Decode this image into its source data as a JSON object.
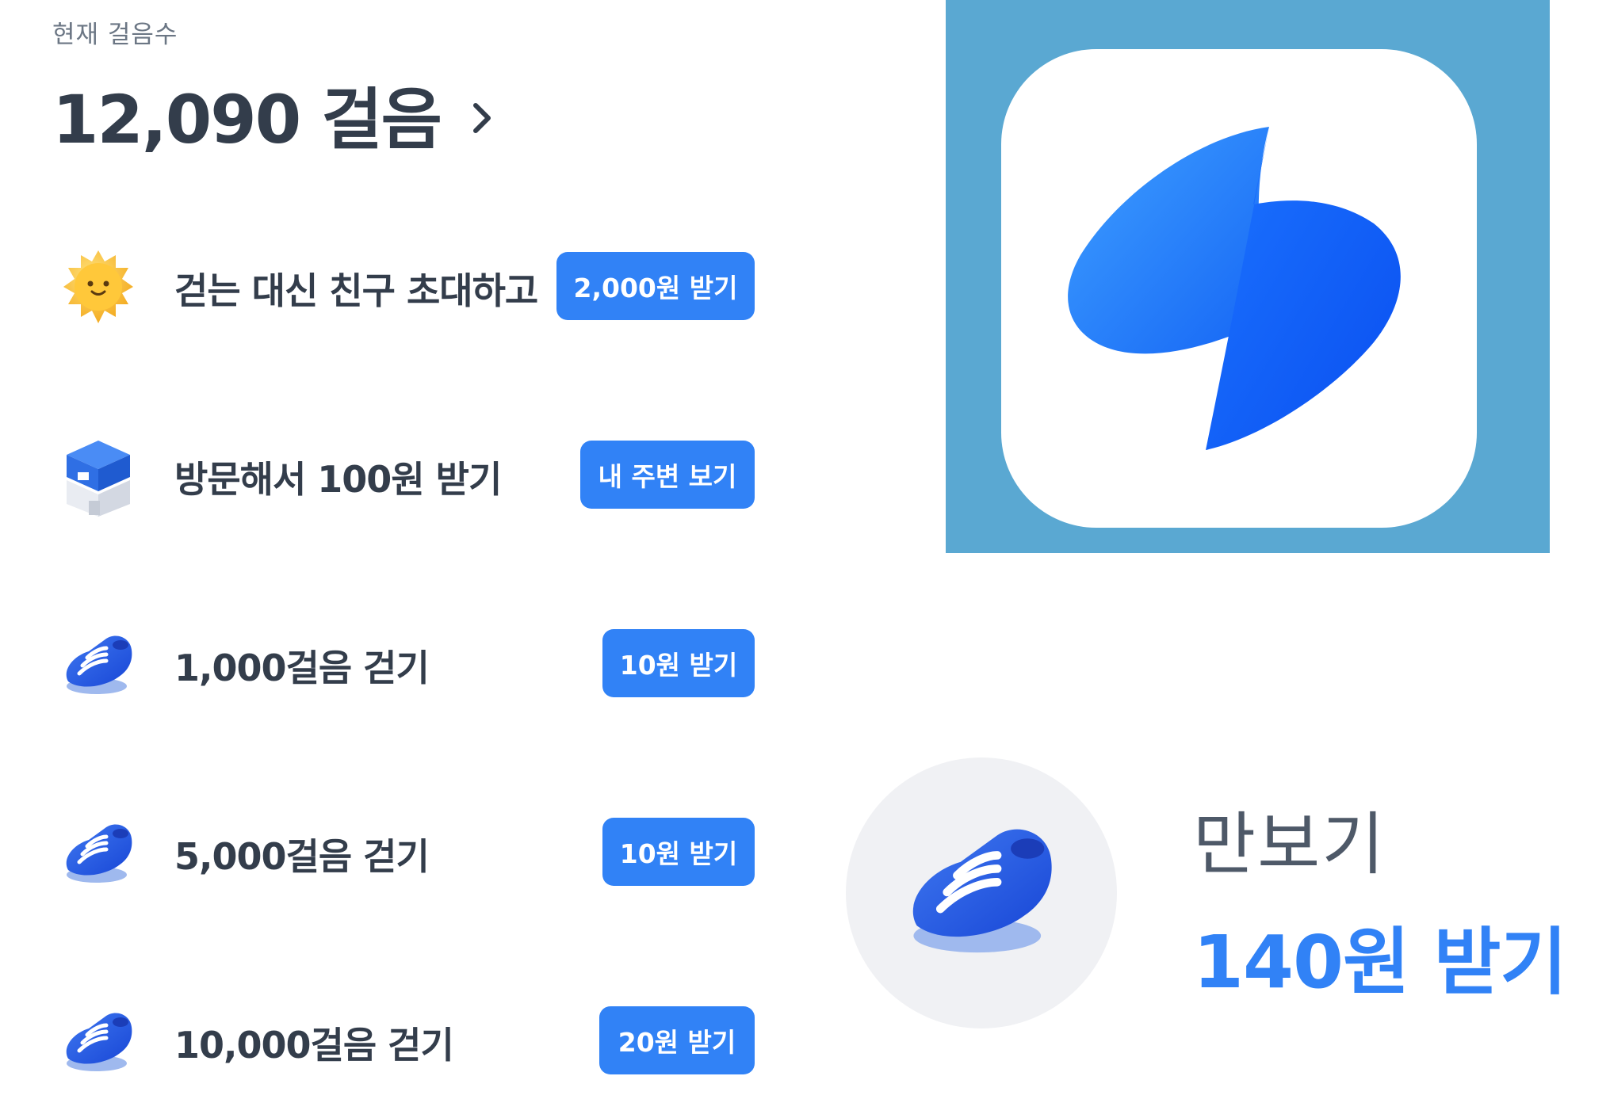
{
  "header": {
    "label": "현재 걸음수",
    "steps": "12,090 걸음"
  },
  "missions": [
    {
      "icon": "sun-icon",
      "title": "걷는 대신 친구 초대하고",
      "button": "2,000원 받기"
    },
    {
      "icon": "store-icon",
      "title": "방문해서 100원 받기",
      "button": "내 주변 보기"
    },
    {
      "icon": "shoe-icon",
      "title": "1,000걸음 걷기",
      "button": "10원 받기"
    },
    {
      "icon": "shoe-icon",
      "title": "5,000걸음 걷기",
      "button": "10원 받기"
    },
    {
      "icon": "shoe-icon",
      "title": "10,000걸음 걷기",
      "button": "20원 받기"
    }
  ],
  "feature": {
    "icon": "shoe-icon",
    "title": "만보기",
    "reward": "140원 받기"
  },
  "app_icon": {
    "icon": "toss-logo-icon"
  },
  "colors": {
    "accent": "#3182f6",
    "text_primary": "#333d4b",
    "text_secondary": "#6b7684",
    "icon_panel_bg": "#5aa8d2"
  }
}
